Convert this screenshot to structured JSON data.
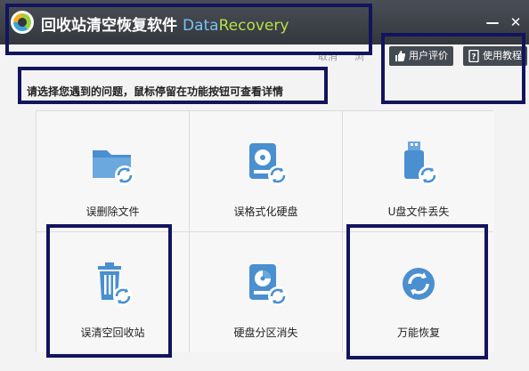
{
  "title": {
    "app_name": "回收站清空恢复软件",
    "brand_part1": "Data",
    "brand_part2": "Recovery",
    "minimize_glyph": "—",
    "close_glyph": "✕"
  },
  "toolbar": {
    "faint_left": "取消",
    "faint_right": "浏",
    "review_button": "用户评价",
    "tutorial_button": "使用教程"
  },
  "hint": "请选择您遇到的问题，鼠标停留在功能按钮可查看详情",
  "cards": [
    {
      "label": "误删除文件",
      "icon": "folder-recover-icon"
    },
    {
      "label": "误格式化硬盘",
      "icon": "harddisk-format-icon"
    },
    {
      "label": "U盘文件丢失",
      "icon": "usb-drive-icon"
    },
    {
      "label": "误清空回收站",
      "icon": "recycle-bin-icon"
    },
    {
      "label": "硬盘分区消失",
      "icon": "partition-lost-icon"
    },
    {
      "label": "万能恢复",
      "icon": "universal-recover-icon"
    }
  ],
  "colors": {
    "titlebar": "#3a3e44",
    "icon_blue": "#4a8fcf",
    "annotation_frame": "#12145e"
  }
}
